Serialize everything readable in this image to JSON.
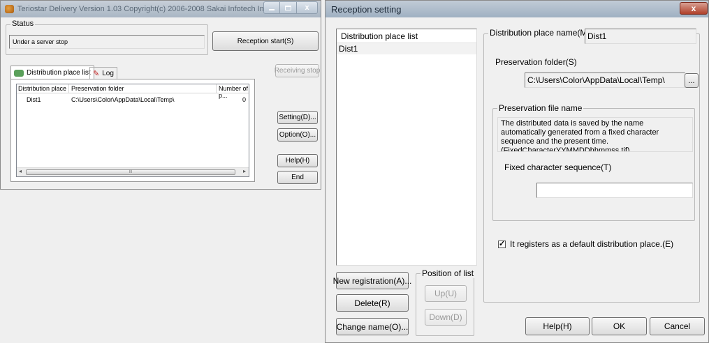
{
  "left_window": {
    "title": "Teriostar Delivery  Version 1.03 Copyright(c) 2006-2008 Sakai Infotech Inc.",
    "status": {
      "label": "Status",
      "value": "Under a server stop"
    },
    "reception_start": "Reception start(S)",
    "receiving_stop": "Receiving stop",
    "tabs": [
      "Distribution place list",
      "Log"
    ],
    "columns": [
      "Distribution place",
      "Preservation folder",
      "Number of p..."
    ],
    "rows": [
      {
        "place": "Dist1",
        "folder": "C:\\Users\\Color\\AppData\\Local\\Temp\\",
        "count": "0"
      }
    ],
    "scroll_thumb": "III",
    "buttons": {
      "setting": "Setting(D)...",
      "option": "Option(O)...",
      "help": "Help(H)",
      "end": "End"
    }
  },
  "right_window": {
    "title": "Reception setting",
    "list_header": "Distribution place list",
    "list_items": [
      "Dist1"
    ],
    "new_registration": "New registration(A)...",
    "delete": "Delete(R)",
    "change_name": "Change name(O)...",
    "position_label": "Position of list",
    "up": "Up(U)",
    "down": "Down(D)",
    "place_name_label": "Distribution place name(M)",
    "place_name_value": "Dist1",
    "preservation_folder_label": "Preservation folder(S)",
    "preservation_folder_value": "C:\\Users\\Color\\AppData\\Local\\Temp\\",
    "browse": "...",
    "file_name_label": "Preservation file name",
    "file_name_description": "The distributed data is saved by the name automatically generated from a fixed character sequence and the present time.(FixedCharacterYYMMDDhhmmss.tif)",
    "fixed_seq_label": "Fixed character sequence(T)",
    "fixed_seq_value": "",
    "default_checkbox_label": "It registers as a default distribution place.(E)",
    "default_checked": true,
    "help": "Help(H)",
    "ok": "OK",
    "cancel": "Cancel"
  }
}
